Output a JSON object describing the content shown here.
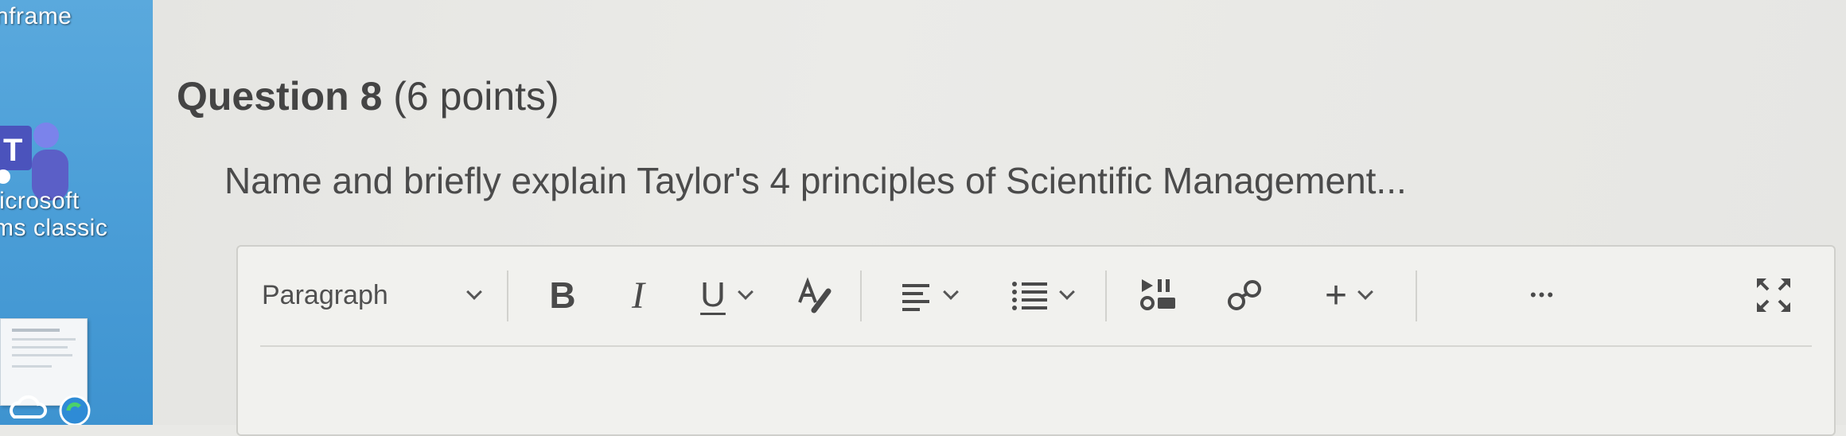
{
  "desktop": {
    "label_top": "nframe",
    "label_app_line1": "licrosoft",
    "label_app_line2": "ms classic"
  },
  "question": {
    "name": "Question 8",
    "points": "(6 points)",
    "text": "Name and briefly explain Taylor's 4 principles of Scientific Management..."
  },
  "toolbar": {
    "paragraph_label": "Paragraph",
    "bold_label": "B",
    "italic_label": "I",
    "underline_label": "U",
    "add_label": "+",
    "more_label": "•••"
  },
  "colors": {
    "desktop_blue": "#4c9fd8",
    "teams_purple": "#5b5fc7",
    "page_bg": "#e9e9e6",
    "text": "#4a4a4a"
  },
  "icons": [
    "teams-icon",
    "chevron-down-icon",
    "text-format-icon",
    "align-icon",
    "list-icon",
    "media-icon",
    "link-icon",
    "plus-icon",
    "more-icon",
    "fullscreen-icon"
  ]
}
